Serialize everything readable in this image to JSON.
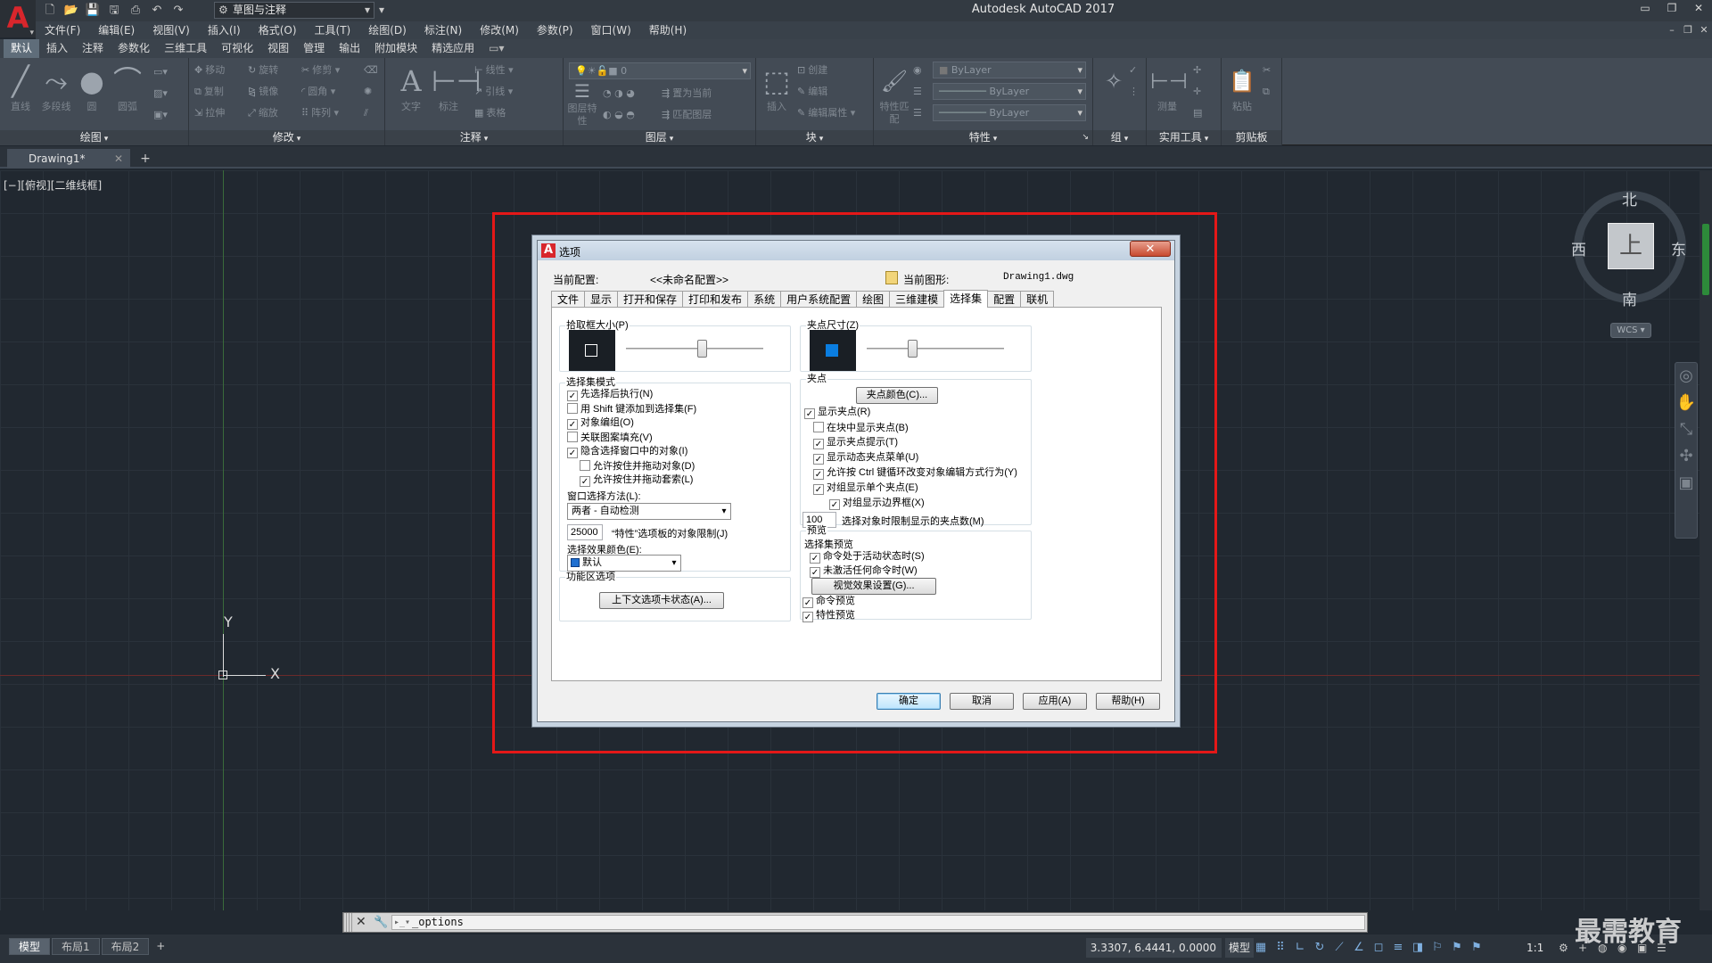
{
  "app": {
    "title": "Autodesk AutoCAD 2017",
    "logo": "A",
    "workspace": "草图与注释",
    "qat_icons": [
      "new-icon",
      "open-icon",
      "save-icon",
      "saveas-icon",
      "print-icon",
      "undo-icon",
      "redo-icon"
    ]
  },
  "menubar": {
    "items": [
      "文件(F)",
      "编辑(E)",
      "视图(V)",
      "插入(I)",
      "格式(O)",
      "工具(T)",
      "绘图(D)",
      "标注(N)",
      "修改(M)",
      "参数(P)",
      "窗口(W)",
      "帮助(H)"
    ]
  },
  "ribbon": {
    "tabs": [
      "默认",
      "插入",
      "注释",
      "参数化",
      "三维工具",
      "可视化",
      "视图",
      "管理",
      "输出",
      "附加模块",
      "精选应用"
    ],
    "active_tab": "默认",
    "panels": {
      "draw": {
        "title": "绘图",
        "tools": [
          "直线",
          "多段线",
          "圆",
          "圆弧"
        ]
      },
      "modify": {
        "title": "修改",
        "tools": [
          "移动",
          "旋转",
          "修剪",
          "复制",
          "镜像",
          "圆角",
          "拉伸",
          "缩放",
          "阵列"
        ]
      },
      "annotation": {
        "title": "注释",
        "tools": [
          "文字",
          "标注",
          "线性",
          "引线",
          "表格"
        ]
      },
      "layers": {
        "title": "图层",
        "tools": [
          "图层特性",
          "置为当前",
          "匹配图层"
        ],
        "layer_value": "0"
      },
      "block": {
        "title": "块",
        "tools": [
          "插入",
          "创建",
          "编辑",
          "编辑属性"
        ]
      },
      "properties": {
        "title": "特性",
        "tools": [
          "特性匹配"
        ],
        "bylayer1": "ByLayer",
        "bylayer2": "ByLayer",
        "bylayer3": "ByLayer"
      },
      "groups": {
        "title": "组"
      },
      "utilities": {
        "title": "实用工具",
        "tools": [
          "测量"
        ]
      },
      "clipboard": {
        "title": "剪贴板",
        "tools": [
          "粘贴"
        ]
      }
    }
  },
  "doc_tabs": {
    "active": "Drawing1*"
  },
  "viewport": {
    "label": "[−][俯视][二维线框]",
    "ucs_x": "X",
    "ucs_y": "Y"
  },
  "viewcube": {
    "top_face": "上",
    "north": "北",
    "south": "南",
    "east": "东",
    "west": "西",
    "wcs": "WCS"
  },
  "dialog": {
    "title": "选项",
    "current_profile_label": "当前配置:",
    "current_profile_value": "<<未命名配置>>",
    "current_drawing_label": "当前图形:",
    "current_drawing_value": "Drawing1.dwg",
    "tabs": [
      "文件",
      "显示",
      "打开和保存",
      "打印和发布",
      "系统",
      "用户系统配置",
      "绘图",
      "三维建模",
      "选择集",
      "配置",
      "联机"
    ],
    "active_tab": "选择集",
    "pickbox": {
      "title": "拾取框大小(P)",
      "level": 0.55
    },
    "grip_size": {
      "title": "夹点尺寸(Z)",
      "level": 0.33
    },
    "selection_modes": {
      "title": "选择集模式",
      "items": [
        {
          "label": "先选择后执行(N)",
          "checked": true
        },
        {
          "label": "用 Shift 键添加到选择集(F)",
          "checked": false
        },
        {
          "label": "对象编组(O)",
          "checked": true
        },
        {
          "label": "关联图案填充(V)",
          "checked": false
        },
        {
          "label": "隐含选择窗口中的对象(I)",
          "checked": true
        },
        {
          "label": "允许按住并拖动对象(D)",
          "checked": false
        },
        {
          "label": "允许按住并拖动套索(L)",
          "checked": true
        }
      ],
      "window_method_label": "窗口选择方法(L):",
      "window_method_value": "两者 - 自动检测",
      "limit_value": "25000",
      "limit_label": "“特性”选项板的对象限制(J)",
      "effect_color_label": "选择效果颜色(E):",
      "effect_color_value": "默认"
    },
    "ribbon_options": {
      "title": "功能区选项",
      "button": "上下文选项卡状态(A)..."
    },
    "grips": {
      "title": "夹点",
      "color_button": "夹点颜色(C)...",
      "items": [
        {
          "label": "显示夹点(R)",
          "checked": true
        },
        {
          "label": "在块中显示夹点(B)",
          "checked": false
        },
        {
          "label": "显示夹点提示(T)",
          "checked": true
        },
        {
          "label": "显示动态夹点菜单(U)",
          "checked": true
        },
        {
          "label": "允许按 Ctrl 键循环改变对象编辑方式行为(Y)",
          "checked": true
        },
        {
          "label": "对组显示单个夹点(E)",
          "checked": true
        },
        {
          "label": "对组显示边界框(X)",
          "checked": true
        }
      ],
      "limit_value": "100",
      "limit_label": "选择对象时限制显示的夹点数(M)"
    },
    "preview": {
      "title": "预览",
      "subtitle": "选择集预览",
      "items": [
        {
          "label": "命令处于活动状态时(S)",
          "checked": true
        },
        {
          "label": "未激活任何命令时(W)",
          "checked": true
        }
      ],
      "visual_button": "视觉效果设置(G)...",
      "extra": [
        {
          "label": "命令预览",
          "checked": true
        },
        {
          "label": "特性预览",
          "checked": true
        }
      ]
    },
    "buttons": {
      "ok": "确定",
      "cancel": "取消",
      "apply": "应用(A)",
      "help": "帮助(H)"
    }
  },
  "commandline": {
    "value": "_options"
  },
  "statusbar": {
    "layout_tabs": [
      "模型",
      "布局1",
      "布局2"
    ],
    "coords": "3.3307, 6.4441, 0.0000",
    "model": "模型",
    "scale": "1:1"
  },
  "watermark": "最需教育"
}
